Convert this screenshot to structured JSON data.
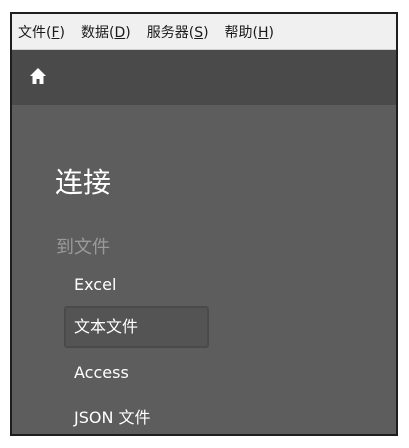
{
  "menu": [
    {
      "label": "文件(",
      "mnemonic": "F",
      "close": ")"
    },
    {
      "label": "数据(",
      "mnemonic": "D",
      "close": ")"
    },
    {
      "label": "服务器(",
      "mnemonic": "S",
      "close": ")"
    },
    {
      "label": "帮助(",
      "mnemonic": "H",
      "close": ")"
    }
  ],
  "toolbar": {
    "home_icon": "home-icon"
  },
  "connect": {
    "title": "连接",
    "section_label": "到文件",
    "items": [
      "Excel",
      "文本文件",
      "Access",
      "JSON 文件"
    ],
    "selected_index": 1
  },
  "colors": {
    "panel_bg": "#5d5d5d",
    "toolbar_bg": "#4a4a4a",
    "menubar_bg": "#f0f0f0",
    "muted_text": "#9a9a9a"
  }
}
